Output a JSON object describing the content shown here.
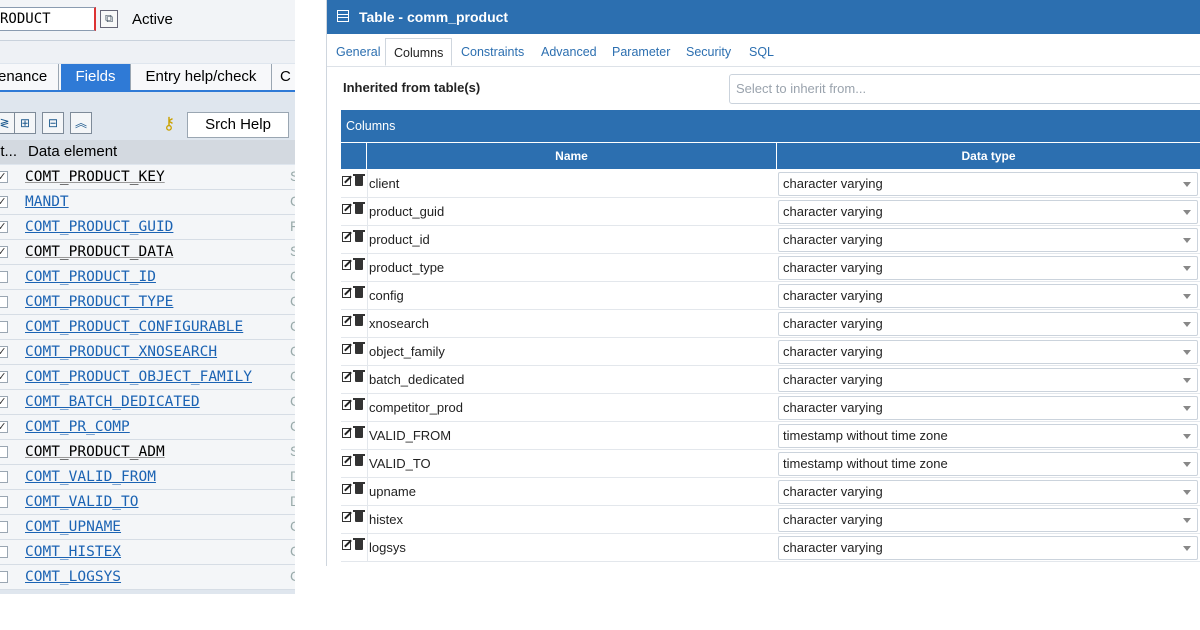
{
  "sap": {
    "table_name": "RODUCT",
    "status": "Active",
    "tabs": [
      {
        "label": "enance"
      },
      {
        "label": "Fields"
      },
      {
        "label": "Entry help/check"
      },
      {
        "label": "C"
      }
    ],
    "toolbar": {
      "srch_help": "Srch Help"
    },
    "header": {
      "col1": "it...",
      "col2": "Data element"
    },
    "rows": [
      {
        "checked": true,
        "element": "COMT_PRODUCT_KEY",
        "link": false,
        "rc": "S"
      },
      {
        "checked": true,
        "element": "MANDT",
        "link": true,
        "rc": "C"
      },
      {
        "checked": true,
        "element": "COMT_PRODUCT_GUID",
        "link": true,
        "rc": "F"
      },
      {
        "checked": true,
        "element": "COMT_PRODUCT_DATA",
        "link": false,
        "rc": "S"
      },
      {
        "checked": false,
        "element": "COMT_PRODUCT_ID",
        "link": true,
        "rc": "C"
      },
      {
        "checked": false,
        "element": "COMT_PRODUCT_TYPE",
        "link": true,
        "rc": "C"
      },
      {
        "checked": false,
        "element": "COMT_PRODUCT_CONFIGURABLE",
        "link": true,
        "rc": "C"
      },
      {
        "checked": true,
        "element": "COMT_PRODUCT_XNOSEARCH",
        "link": true,
        "rc": "C"
      },
      {
        "checked": true,
        "element": "COMT_PRODUCT_OBJECT_FAMILY",
        "link": true,
        "rc": "C"
      },
      {
        "checked": true,
        "element": "COMT_BATCH_DEDICATED",
        "link": true,
        "rc": "C"
      },
      {
        "checked": true,
        "element": "COMT_PR_COMP",
        "link": true,
        "rc": "C"
      },
      {
        "checked": false,
        "element": "COMT_PRODUCT_ADM",
        "link": false,
        "rc": "S"
      },
      {
        "checked": false,
        "element": "COMT_VALID_FROM",
        "link": true,
        "rc": "D"
      },
      {
        "checked": false,
        "element": "COMT_VALID_TO",
        "link": true,
        "rc": "D"
      },
      {
        "checked": false,
        "element": "COMT_UPNAME",
        "link": true,
        "rc": "C"
      },
      {
        "checked": false,
        "element": "COMT_HISTEX",
        "link": true,
        "rc": "C"
      },
      {
        "checked": false,
        "element": "COMT_LOGSYS",
        "link": true,
        "rc": "C"
      }
    ]
  },
  "pg": {
    "title": "Table - comm_product",
    "tabs": [
      {
        "label": "General"
      },
      {
        "label": "Columns"
      },
      {
        "label": "Constraints"
      },
      {
        "label": "Advanced"
      },
      {
        "label": "Parameter"
      },
      {
        "label": "Security"
      },
      {
        "label": "SQL"
      }
    ],
    "inherited_label": "Inherited from table(s)",
    "inherit_placeholder": "Select to inherit from...",
    "columns_header": "Columns",
    "grid_headers": {
      "name": "Name",
      "data_type": "Data type"
    },
    "rows": [
      {
        "name": "client",
        "type": "character varying"
      },
      {
        "name": "product_guid",
        "type": "character varying"
      },
      {
        "name": "product_id",
        "type": "character varying"
      },
      {
        "name": "product_type",
        "type": "character varying"
      },
      {
        "name": "config",
        "type": "character varying"
      },
      {
        "name": "xnosearch",
        "type": "character varying"
      },
      {
        "name": "object_family",
        "type": "character varying"
      },
      {
        "name": "batch_dedicated",
        "type": "character varying"
      },
      {
        "name": "competitor_prod",
        "type": "character varying"
      },
      {
        "name": "VALID_FROM",
        "type": "timestamp without time zone"
      },
      {
        "name": "VALID_TO",
        "type": "timestamp without time zone"
      },
      {
        "name": "upname",
        "type": "character varying"
      },
      {
        "name": "histex",
        "type": "character varying"
      },
      {
        "name": "logsys",
        "type": "character varying"
      }
    ]
  }
}
